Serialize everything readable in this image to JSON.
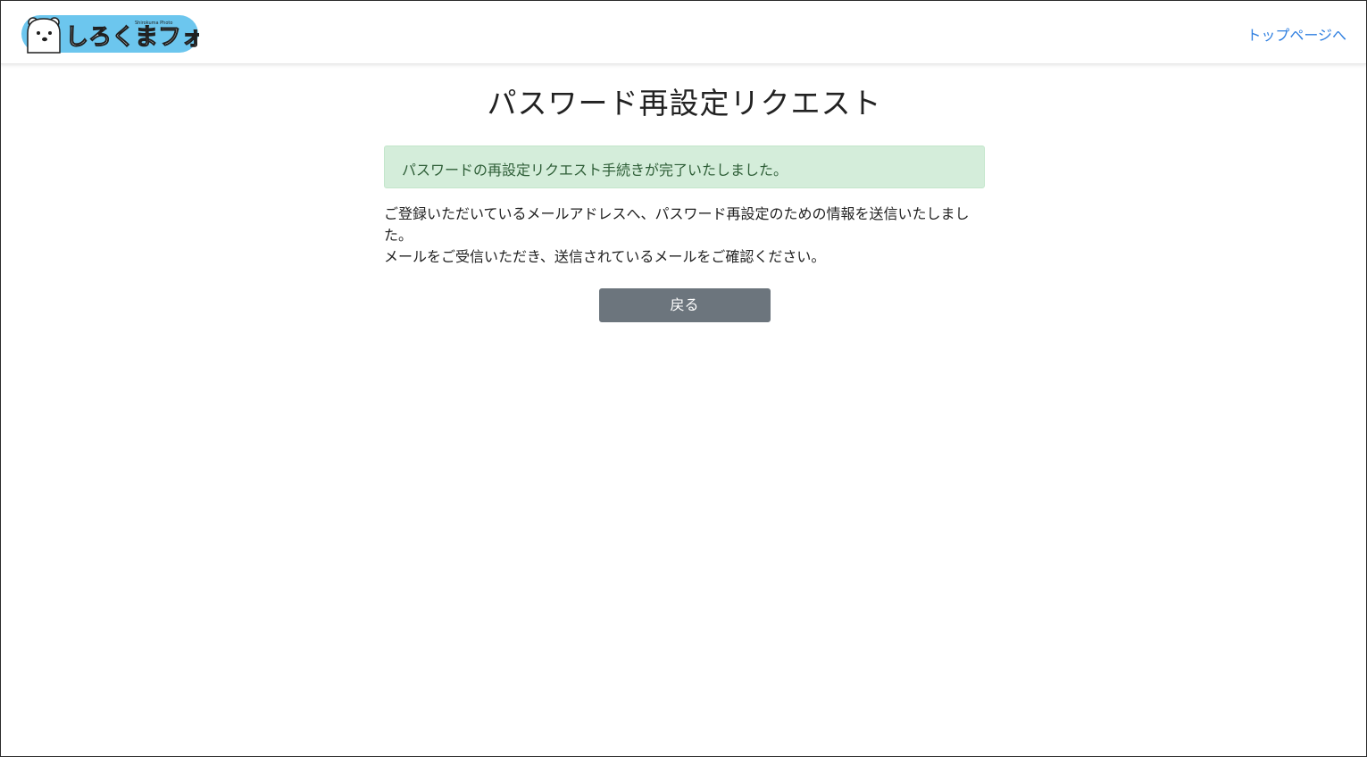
{
  "header": {
    "logo": {
      "text": "しろくまフォト",
      "subtext": "Shirokuma Photo",
      "badge_color": "#6cc6ee"
    },
    "top_link_label": "トップページへ",
    "link_color": "#2f7fe0"
  },
  "main": {
    "title": "パスワード再設定リクエスト",
    "alert_text": "パスワードの再設定リクエスト手続きが完了いたしました。",
    "message_lines": [
      "ご登録いただいているメールアドレスへ、パスワード再設定のための情報を送信いたしました。",
      "メールをご受信いただき、送信されているメールをご確認ください。"
    ],
    "back_button_label": "戻る"
  },
  "colors": {
    "alert_bg": "#d4edda",
    "alert_text": "#2e5e37",
    "button_bg": "#6c757d"
  }
}
